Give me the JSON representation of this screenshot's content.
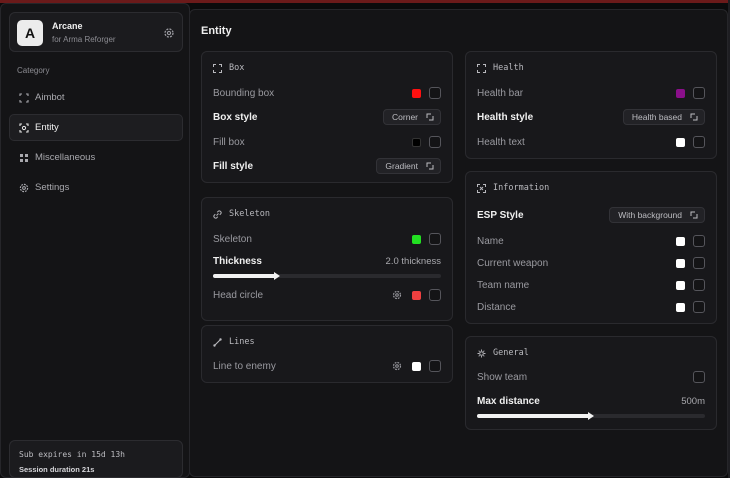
{
  "brand": {
    "initial": "A",
    "name": "Arcane",
    "subtitle": "for Arma Reforger"
  },
  "sidebar": {
    "category_label": "Category",
    "items": [
      {
        "label": "Aimbot",
        "icon": "crosshair-icon"
      },
      {
        "label": "Entity",
        "icon": "target-box-icon"
      },
      {
        "label": "Miscellaneous",
        "icon": "grid-icon"
      },
      {
        "label": "Settings",
        "icon": "gear-icon"
      }
    ],
    "subscription": {
      "expires": "Sub expires in 15d 13h",
      "session": "Session duration 21s"
    }
  },
  "main": {
    "title": "Entity",
    "box": {
      "title": "Box",
      "bounding_box": {
        "label": "Bounding box",
        "color": "#ff1010",
        "checked": false
      },
      "box_style": {
        "label": "Box style",
        "value": "Corner"
      },
      "fill_box": {
        "label": "Fill box",
        "color": "#000000",
        "checked": false
      },
      "fill_style": {
        "label": "Fill style",
        "value": "Gradient"
      }
    },
    "skeleton": {
      "title": "Skeleton",
      "skeleton": {
        "label": "Skeleton",
        "color": "#22e022",
        "checked": false
      },
      "thickness": {
        "label": "Thickness",
        "value": "2.0 thickness",
        "fraction": 0.28
      },
      "head_circle": {
        "label": "Head circle",
        "color": "#f04040",
        "checked": false
      }
    },
    "lines": {
      "title": "Lines",
      "line_to_enemy": {
        "label": "Line to enemy",
        "color": "#ffffff",
        "checked": false
      }
    },
    "health": {
      "title": "Health",
      "health_bar": {
        "label": "Health bar",
        "color": "#8a0f8a",
        "checked": false
      },
      "health_style": {
        "label": "Health style",
        "value": "Health based"
      },
      "health_text": {
        "label": "Health text",
        "color": "#ffffff",
        "checked": false
      }
    },
    "information": {
      "title": "Information",
      "esp_style": {
        "label": "ESP Style",
        "value": "With background"
      },
      "name": {
        "label": "Name",
        "color": "#ffffff",
        "checked": false
      },
      "current_weapon": {
        "label": "Current weapon",
        "color": "#ffffff",
        "checked": false
      },
      "team_name": {
        "label": "Team name",
        "color": "#ffffff",
        "checked": false
      },
      "distance": {
        "label": "Distance",
        "color": "#ffffff",
        "checked": false
      }
    },
    "general": {
      "title": "General",
      "show_team": {
        "label": "Show team",
        "checked": false
      },
      "max_distance": {
        "label": "Max distance",
        "value": "500m",
        "fraction": 0.5
      }
    }
  }
}
